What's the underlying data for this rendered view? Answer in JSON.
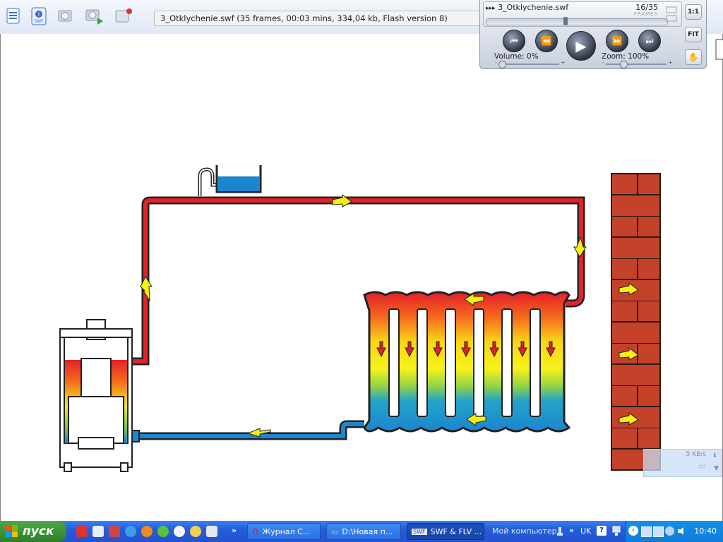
{
  "toolbar": {
    "info": "3_Otklychenie.swf (35 frames, 00:03 mins, 334,04 kb, Flash version 8)",
    "icons": [
      "document-list-icon",
      "swf-info-icon",
      "camera-icon",
      "camera-play-icon",
      "export-icon"
    ]
  },
  "player": {
    "file": "3_Otklychenie.swf",
    "frame_counter": "16/35",
    "frames_label": "FRAMES",
    "volume": "Volume: 0%",
    "zoom": "Zoom: 100%",
    "btn_one_to_one": "1:1",
    "btn_fit": "FIT",
    "seek_position": 0.44,
    "volume_level": 0.0,
    "zoom_level": 0.25
  },
  "download": {
    "speed": "5 KB/s"
  },
  "taskbar": {
    "start_label": "пуск",
    "tasks": [
      {
        "label": "Журнал С...",
        "icon": "opera-icon",
        "active": false
      },
      {
        "label": "D:\\Новая п...",
        "icon": "folder-icon",
        "active": false
      },
      {
        "label": "SWF & FLV ...",
        "icon": "swf-icon",
        "active": true
      }
    ],
    "my_computer": "Мой компьютер",
    "lang": "UK",
    "clock": "10:40"
  },
  "colors": {
    "hot": "#e4202a",
    "cold": "#1a86d0",
    "arrow": "#f7ef12",
    "brick": "#c4422a",
    "pipe_outline": "#222222"
  }
}
